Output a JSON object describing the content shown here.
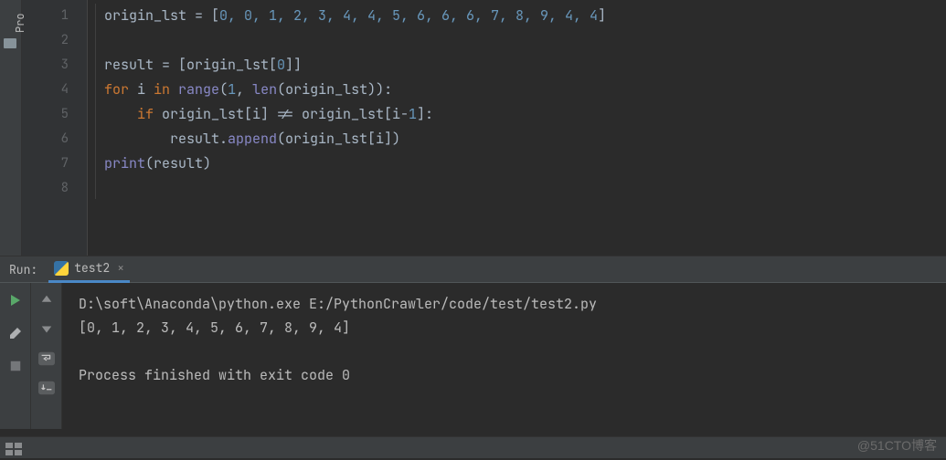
{
  "sidebar": {
    "label": "Pro",
    "folder_icon": "folder-icon"
  },
  "lines": [
    "1",
    "2",
    "3",
    "4",
    "5",
    "6",
    "7",
    "8"
  ],
  "code": {
    "l1_id": "origin_lst ",
    "l1_eq": "= [",
    "l1_nums": "0, 0, 1, 2, 3, 4, 4, 5, 6, 6, 6, 7, 8, 9, 4, 4",
    "l1_close": "]",
    "l3_id": "result ",
    "l3_eq": "= [origin_lst[",
    "l3_n0": "0",
    "l3_close": "]]",
    "l4_for": "for ",
    "l4_i": "i ",
    "l4_in": "in ",
    "l4_range": "range",
    "l4_open": "(",
    "l4_n1": "1",
    "l4_comma": ", ",
    "l4_len": "len",
    "l4_rest": "(origin_lst)):",
    "l5_if": "    if ",
    "l5_cond": "origin_lst[i] != origin_lst[i-",
    "l5_n1": "1",
    "l5_close": "]:",
    "l6_indent": "        result.",
    "l6_append": "append",
    "l6_rest": "(origin_lst[i])",
    "l7_print": "print",
    "l7_rest": "(result)"
  },
  "run": {
    "label": "Run:",
    "tab": "test2",
    "close": "×"
  },
  "output": {
    "cmd": "D:\\soft\\Anaconda\\python.exe E:/PythonCrawler/code/test/test2.py",
    "result": "[0, 1, 2, 3, 4, 5, 6, 7, 8, 9, 4]",
    "blank": "",
    "finished": "Process finished with exit code 0"
  },
  "watermark": "@51CTO博客"
}
